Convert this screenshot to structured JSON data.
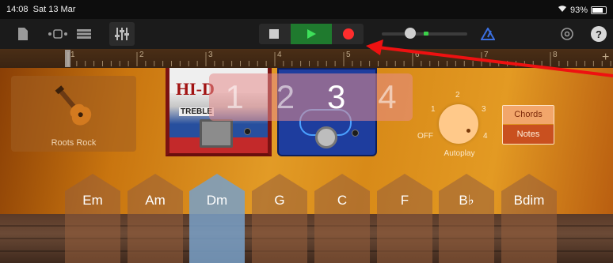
{
  "status_bar": {
    "time": "14:08",
    "date": "Sat 13 Mar",
    "battery": "93%"
  },
  "toolbar": {
    "icons": [
      "document-icon",
      "view-toggle-icon",
      "tracks-icon",
      "mixer-icon",
      "metronome-icon",
      "settings-icon",
      "help-icon"
    ],
    "help_label": "?"
  },
  "ruler": {
    "bars": [
      "1",
      "2",
      "3",
      "4",
      "5",
      "6",
      "7",
      "8"
    ]
  },
  "instrument": {
    "name": "Roots Rock"
  },
  "pedals": {
    "left_brand": "HI-D",
    "left_label": "TREBLE"
  },
  "inversions": {
    "numbers": [
      "1",
      "2",
      "3",
      "4"
    ],
    "selected": "3"
  },
  "autoplay": {
    "title": "Autoplay",
    "labels": {
      "off": "OFF",
      "one": "1",
      "two": "2",
      "three": "3",
      "four": "4"
    },
    "value": "4"
  },
  "mode_toggle": {
    "chords": "Chords",
    "notes": "Notes",
    "selected": "Notes"
  },
  "chords": {
    "items": [
      "Em",
      "Am",
      "Dm",
      "G",
      "C",
      "F",
      "B♭",
      "Bdim"
    ],
    "selected": "Dm"
  },
  "colors": {
    "play": "#1f7a2e",
    "record": "#ff2d2d",
    "level": "#3bd24a",
    "annotation_arrow": "#ee1111"
  }
}
